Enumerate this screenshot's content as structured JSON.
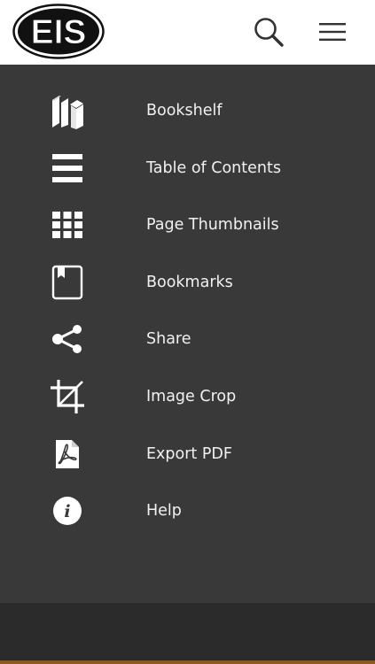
{
  "header": {
    "logo_text": "EIS",
    "search_icon": "search-icon",
    "menu_icon": "hamburger-menu-icon"
  },
  "menu": {
    "items": [
      {
        "label": "Bookshelf",
        "icon": "bookshelf-icon"
      },
      {
        "label": "Table of Contents",
        "icon": "table-of-contents-icon"
      },
      {
        "label": "Page Thumbnails",
        "icon": "grid-thumbnails-icon"
      },
      {
        "label": "Bookmarks",
        "icon": "bookmark-icon"
      },
      {
        "label": "Share",
        "icon": "share-icon"
      },
      {
        "label": "Image Crop",
        "icon": "crop-icon"
      },
      {
        "label": "Export PDF",
        "icon": "pdf-icon"
      },
      {
        "label": "Help",
        "icon": "info-icon"
      }
    ]
  },
  "colors": {
    "header_bg": "#ffffff",
    "menu_bg": "#393939",
    "footer_bg": "#2b2b2b",
    "accent": "#8a5a24",
    "text": "#f1f1f1"
  }
}
